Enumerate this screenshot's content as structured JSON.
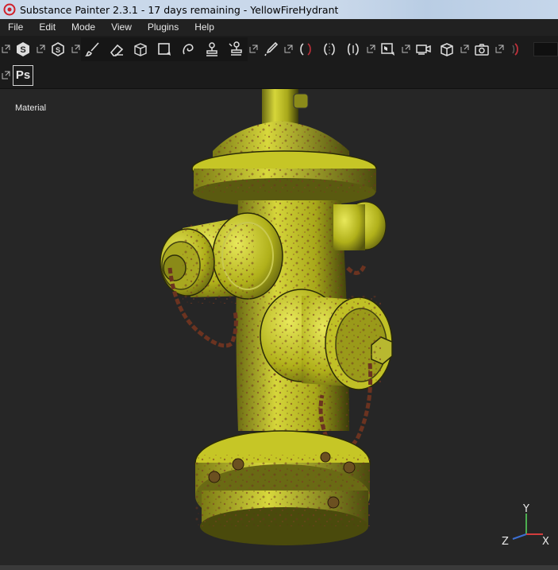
{
  "window": {
    "title": "Substance Painter 2.3.1 - 17 days remaining - YellowFireHydrant"
  },
  "menu": {
    "items": [
      "File",
      "Edit",
      "Mode",
      "View",
      "Plugins",
      "Help"
    ]
  },
  "toolbar": {
    "ps_label": "Ps"
  },
  "viewport": {
    "label": "Material",
    "axis": {
      "y": "Y",
      "z": "Z",
      "x": "X"
    }
  },
  "colors": {
    "hydrant_yellow": "#c8c81e",
    "rust": "#7a3b22",
    "viewport_bg": "#262626",
    "axis_y": "#4caf50",
    "axis_x": "#d23c3c",
    "axis_z": "#3c6fd2"
  }
}
